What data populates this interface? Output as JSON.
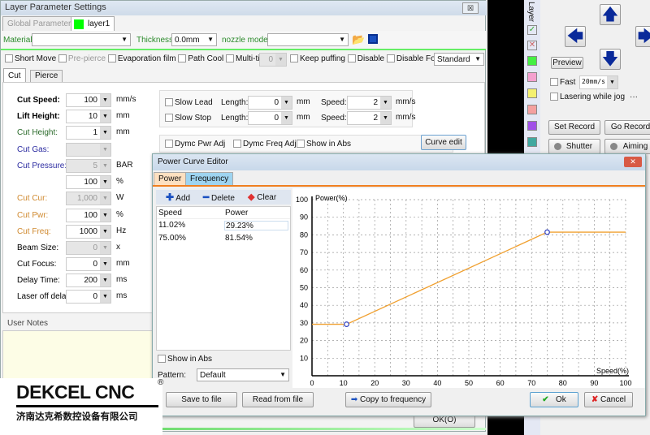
{
  "window": {
    "title": "Layer Parameter Settings",
    "close": "☒"
  },
  "layer_tabs": [
    "Global Parameter",
    "layer1"
  ],
  "layer_color": "#00ff00",
  "toolbar": {
    "material_label": "Material:",
    "material_value": "",
    "thickness_label": "Thickness:",
    "thickness_value": "0.0mm",
    "nozzle_label": "nozzle model:",
    "nozzle_value": ""
  },
  "options": {
    "short_move": "Short Move",
    "pre_pierce": "Pre-pierce",
    "evaporation": "Evaporation film",
    "path_cool": "Path Cool",
    "multi_times": "Multi-times",
    "multi_value": "0",
    "keep_puffing": "Keep puffing",
    "disable": "Disable",
    "disable_follow": "Disable Follow",
    "mode": "Standard"
  },
  "sub_tabs": [
    "Cut",
    "Pierce"
  ],
  "params": [
    {
      "label": "Cut Speed:",
      "value": "100",
      "unit": "mm/s",
      "color": "#000",
      "bold": true
    },
    {
      "label": "Lift Height:",
      "value": "10",
      "unit": "mm",
      "color": "#000",
      "bold": true
    },
    {
      "label": "Cut Height:",
      "value": "1",
      "unit": "mm",
      "color": "#2a6a2a"
    },
    {
      "label": "Cut Gas:",
      "value": "",
      "unit": "",
      "color": "#2a2aa0",
      "disabled": true
    },
    {
      "label": "Cut Pressure:",
      "value": "5",
      "unit": "BAR",
      "color": "#2a2aa0",
      "disabled": true
    },
    {
      "label": "",
      "value": "100",
      "unit": "%",
      "color": "#000"
    },
    {
      "label": "Cut Cur:",
      "value": "1,000",
      "unit": "W",
      "color": "#d08a30",
      "disabled": true
    },
    {
      "label": "Cut Pwr:",
      "value": "100",
      "unit": "%",
      "color": "#d08a30"
    },
    {
      "label": "Cut Freq:",
      "value": "1000",
      "unit": "Hz",
      "color": "#d08a30"
    },
    {
      "label": "Beam Size:",
      "value": "0",
      "unit": "x",
      "color": "#000",
      "disabled": true
    },
    {
      "label": "Cut Focus:",
      "value": "0",
      "unit": "mm",
      "color": "#000"
    },
    {
      "label": "Delay Time:",
      "value": "200",
      "unit": "ms",
      "color": "#000"
    },
    {
      "label": "Laser off delay",
      "value": "0",
      "unit": "ms",
      "color": "#000"
    }
  ],
  "slow": {
    "lead": "Slow Lead",
    "stop": "Slow Stop",
    "length_label": "Length:",
    "length_unit": "mm",
    "speed_label": "Speed:",
    "speed_unit": "mm/s",
    "lead_length": "0",
    "lead_speed": "2",
    "stop_length": "0",
    "stop_speed": "2"
  },
  "dymc": {
    "pwr": "Dymc Pwr Adj",
    "freq": "Dymc Freq Adj",
    "abs": "Show in Abs",
    "curve_edit": "Curve edit"
  },
  "user_notes": "User Notes",
  "ok_behind": "OK(O)",
  "logo": {
    "name": "DEKCEL CNC",
    "reg": "®",
    "company": "济南达克希数控设备有限公司"
  },
  "right_panel": {
    "layer_label": "Layer",
    "preview": "Preview",
    "fast": "Fast",
    "fast_speed": "20mm/s",
    "lasering": "Lasering while jog",
    "more": "···",
    "set_record": "Set Record",
    "go_record": "Go Record",
    "shutter": "Shutter",
    "aiming": "Aiming",
    "swatches": [
      "#44ee44",
      "#f4a0d0",
      "#f4f070",
      "#f4a0a0",
      "#a050e8",
      "#40a8a0"
    ]
  },
  "editor": {
    "title": "Power Curve Editor",
    "close": "✕",
    "tabs": [
      "Power",
      "Frequency"
    ],
    "add": "Add",
    "delete": "Delete",
    "clear": "Clear",
    "columns": [
      "Speed",
      "Power"
    ],
    "rows": [
      [
        "11.02%",
        "29.23%"
      ],
      [
        "75.00%",
        "81.54%"
      ]
    ],
    "show_abs": "Show in Abs",
    "pattern_label": "Pattern:",
    "pattern_value": "Default",
    "save": "Save to file",
    "read": "Read from file",
    "copy": "Copy to frequency",
    "ok": "Ok",
    "cancel": "Cancel"
  },
  "chart_data": {
    "type": "line",
    "xlabel": "Speed(%)",
    "ylabel": "Power(%)",
    "xlim": [
      0,
      100
    ],
    "ylim": [
      0,
      100
    ],
    "xticks": [
      "0",
      "10",
      "20",
      "30",
      "40",
      "50",
      "60",
      "70",
      "80",
      "90",
      "100"
    ],
    "yticks": [
      "10",
      "20",
      "30",
      "40",
      "50",
      "60",
      "70",
      "80",
      "90",
      "100"
    ],
    "grid": true,
    "series": [
      {
        "x": [
          0,
          11.02,
          75,
          100
        ],
        "y": [
          29.23,
          29.23,
          81.54,
          81.54
        ],
        "color": "#f0a030"
      }
    ],
    "points": [
      {
        "x": 11.02,
        "y": 29.23
      },
      {
        "x": 75,
        "y": 81.54
      }
    ]
  }
}
